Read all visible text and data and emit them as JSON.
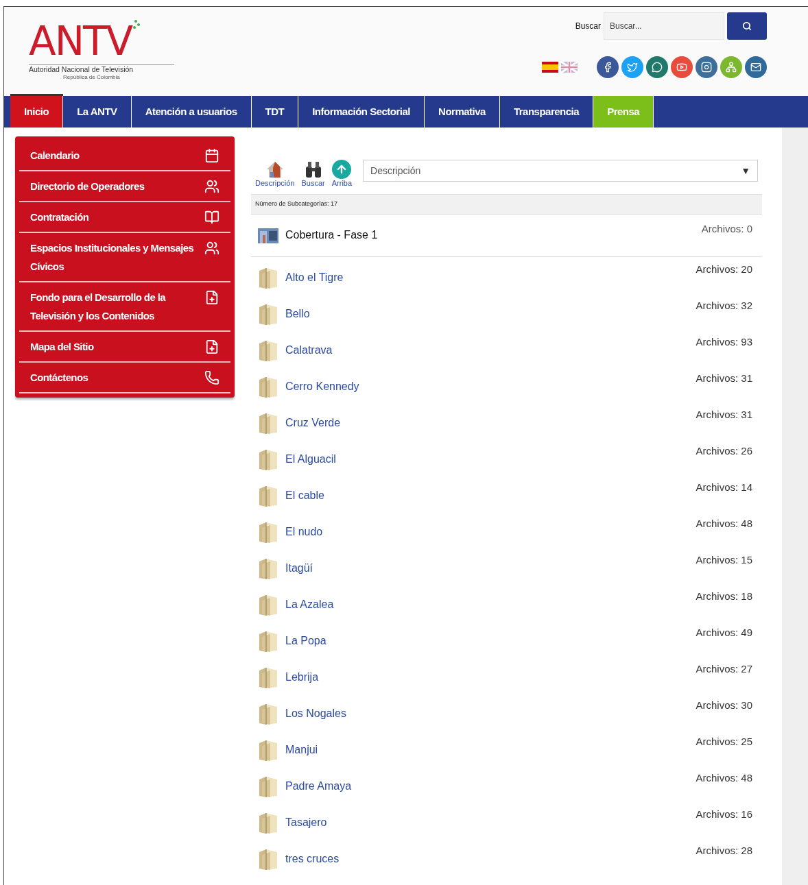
{
  "header": {
    "logo": {
      "wordmark": "ANTV",
      "subtitle": "Autoridad Nacional de Televisión",
      "country": "República de Colombia"
    },
    "search": {
      "label": "Buscar",
      "placeholder": "Buscar..."
    }
  },
  "languages": [
    {
      "kind": "es"
    },
    {
      "kind": "en"
    }
  ],
  "social": [
    {
      "kind": "facebook",
      "color": "#3b5998"
    },
    {
      "kind": "twitter",
      "color": "#1da1f2"
    },
    {
      "kind": "whatsapp",
      "color": "#1f7a6c"
    },
    {
      "kind": "youtube",
      "color": "#e74c3c"
    },
    {
      "kind": "instagram",
      "color": "#3e6f9a"
    },
    {
      "kind": "sitemap",
      "color": "#7cb82f"
    },
    {
      "kind": "mail",
      "color": "#2f6a9a"
    }
  ],
  "nav": [
    {
      "label": "Inicio",
      "selected": true,
      "accent": false
    },
    {
      "label": "La ANTV",
      "selected": false,
      "accent": false
    },
    {
      "label": "Atención a usuarios",
      "selected": false,
      "accent": false
    },
    {
      "label": "TDT",
      "selected": false,
      "accent": false
    },
    {
      "label": "Información Sectorial",
      "selected": false,
      "accent": false
    },
    {
      "label": "Normativa",
      "selected": false,
      "accent": false
    },
    {
      "label": "Transparencia",
      "selected": false,
      "accent": false
    },
    {
      "label": "Prensa",
      "selected": false,
      "accent": true
    }
  ],
  "sidebar": {
    "items": [
      {
        "label": "Calendario",
        "kind": "calendar"
      },
      {
        "label": "Directorio de Operadores",
        "kind": "users"
      },
      {
        "label": "Contratación",
        "kind": "book"
      },
      {
        "label": "Espacios Institucionales y Mensajes Cívicos",
        "kind": "users"
      },
      {
        "label": "Fondo para el Desarrollo de la Televisión y los Contenidos",
        "kind": "file-plus"
      },
      {
        "label": "Mapa del Sitio",
        "kind": "file-plus"
      },
      {
        "label": "Contáctenos",
        "kind": "phone"
      }
    ]
  },
  "toolbar": {
    "buttons": [
      {
        "label": "Descripción",
        "kind": "description"
      },
      {
        "label": "Buscar",
        "kind": "binoculars"
      },
      {
        "label": "Arriba",
        "kind": "up"
      }
    ],
    "select": {
      "value": "Descripción",
      "arrow": "▼"
    }
  },
  "subcategory_count": "Número de Subcategorías: 17",
  "category": {
    "name": "Cobertura - Fase 1",
    "files": "Archivos: 0"
  },
  "folders": [
    {
      "name": "Alto el Tigre",
      "files": "Archivos: 20"
    },
    {
      "name": "Bello",
      "files": "Archivos: 32"
    },
    {
      "name": "Calatrava",
      "files": "Archivos: 93"
    },
    {
      "name": "Cerro Kennedy",
      "files": "Archivos: 31"
    },
    {
      "name": "Cruz Verde",
      "files": "Archivos: 31"
    },
    {
      "name": "El Alguacil",
      "files": "Archivos: 26"
    },
    {
      "name": "El cable",
      "files": "Archivos: 14"
    },
    {
      "name": "El nudo",
      "files": "Archivos: 48"
    },
    {
      "name": "Itagüí",
      "files": "Archivos: 15"
    },
    {
      "name": "La Azalea",
      "files": "Archivos: 18"
    },
    {
      "name": "La Popa",
      "files": "Archivos: 49"
    },
    {
      "name": "Lebrija",
      "files": "Archivos: 27"
    },
    {
      "name": "Los Nogales",
      "files": "Archivos: 30"
    },
    {
      "name": "Manjui",
      "files": "Archivos: 25"
    },
    {
      "name": "Padre Amaya",
      "files": "Archivos: 48"
    },
    {
      "name": "Tasajero",
      "files": "Archivos: 16"
    },
    {
      "name": "tres cruces",
      "files": "Archivos: 28"
    }
  ]
}
